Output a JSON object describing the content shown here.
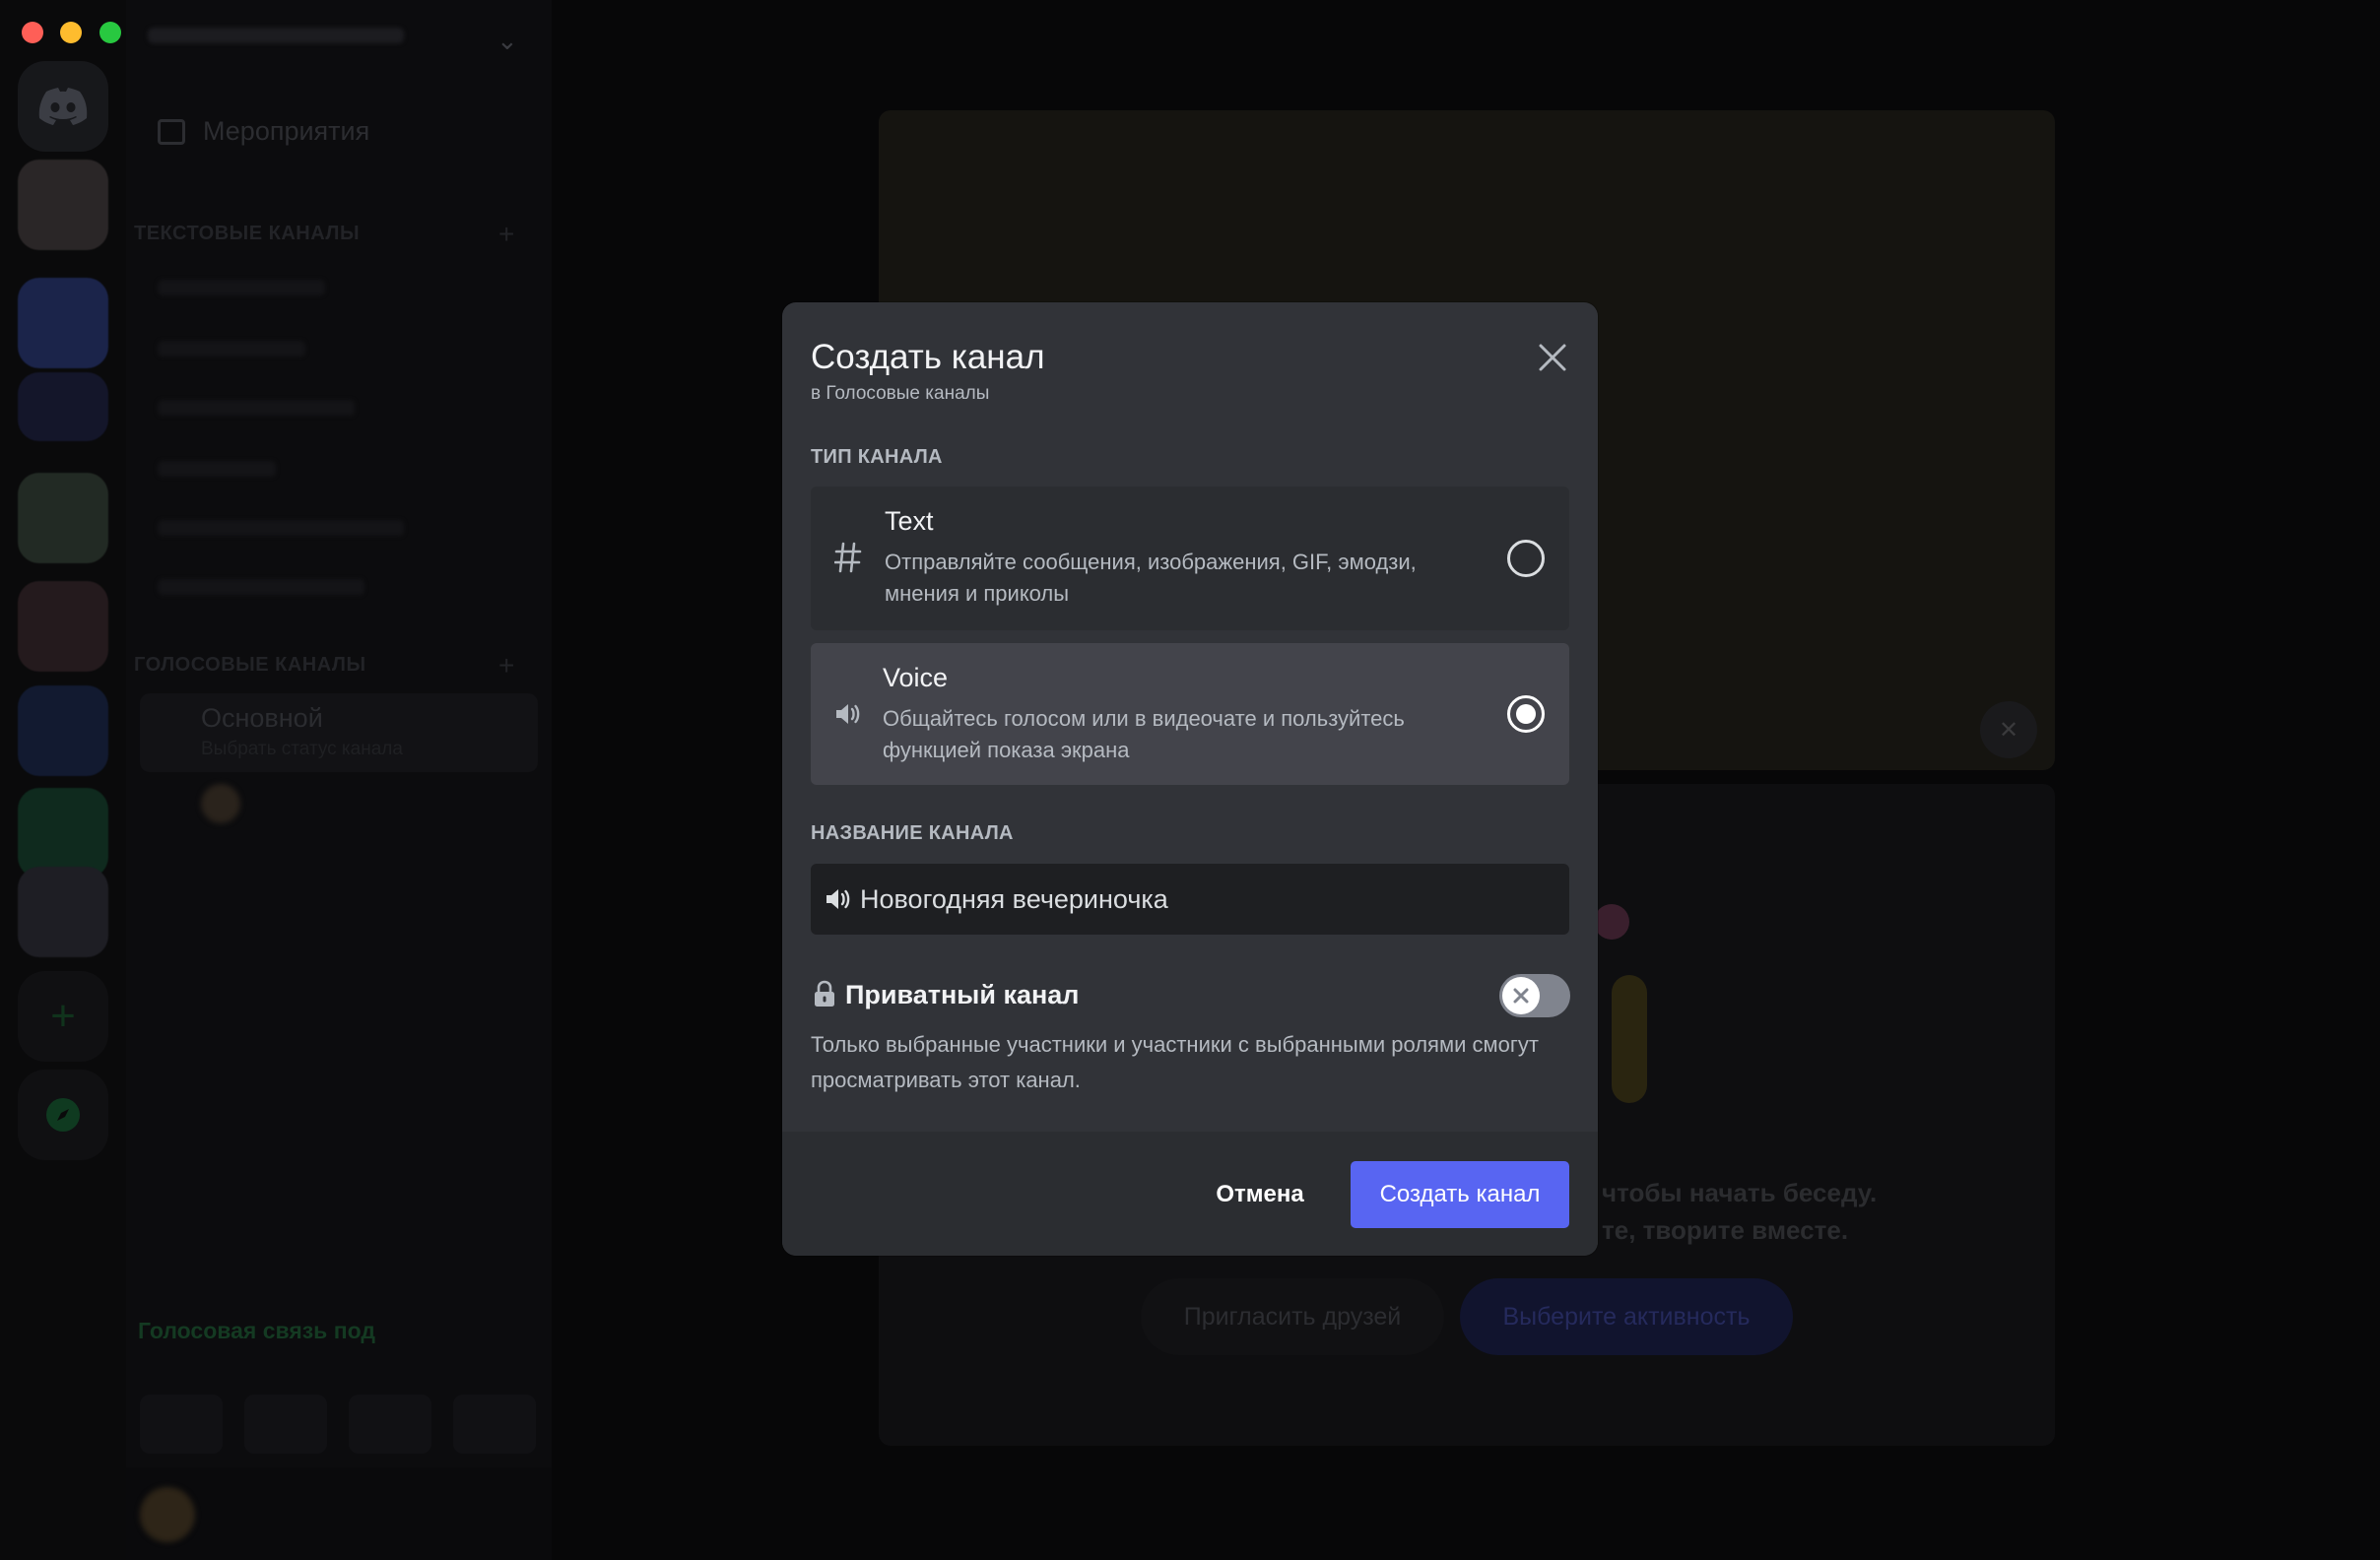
{
  "window": {
    "traffic_lights": [
      "close",
      "minimize",
      "zoom"
    ]
  },
  "sidebar": {
    "events_label": "Мероприятия",
    "text_category": "ТЕКСТОВЫЕ КАНАЛЫ",
    "voice_category": "ГОЛОСОВЫЕ КАНАЛЫ",
    "voice_channel_name": "Основной",
    "voice_channel_status": "Выбрать статус канала",
    "voice_connected": "Голосовая связь под"
  },
  "main": {
    "prompt_line1": "чтобы начать беседу.",
    "prompt_line2": "те, творите вместе.",
    "invite_button": "Пригласить друзей",
    "activity_button": "Выберите активность"
  },
  "modal": {
    "title": "Создать канал",
    "subtitle": "в Голосовые каналы",
    "channel_type_label": "ТИП КАНАЛА",
    "options": [
      {
        "title": "Text",
        "description": "Отправляйте сообщения, изображения, GIF, эмодзи, мнения и приколы",
        "icon": "hash-icon",
        "selected": false
      },
      {
        "title": "Voice",
        "description": "Общайтесь голосом или в видеочате и пользуйтесь функцией показа экрана",
        "icon": "speaker-icon",
        "selected": true
      }
    ],
    "channel_name_label": "НАЗВАНИЕ КАНАЛА",
    "channel_name_value": "Новогодняя вечериночка",
    "private_label": "Приватный канал",
    "private_enabled": false,
    "private_description": "Только выбранные участники и участники с выбранными ролями смогут просматривать этот канал.",
    "cancel_label": "Отмена",
    "create_label": "Создать канал"
  },
  "colors": {
    "accent": "#5865f2",
    "modal_bg": "#313338",
    "footer_bg": "#2b2d31",
    "selected_option_bg": "#43444b",
    "input_bg": "#1e1f22"
  }
}
